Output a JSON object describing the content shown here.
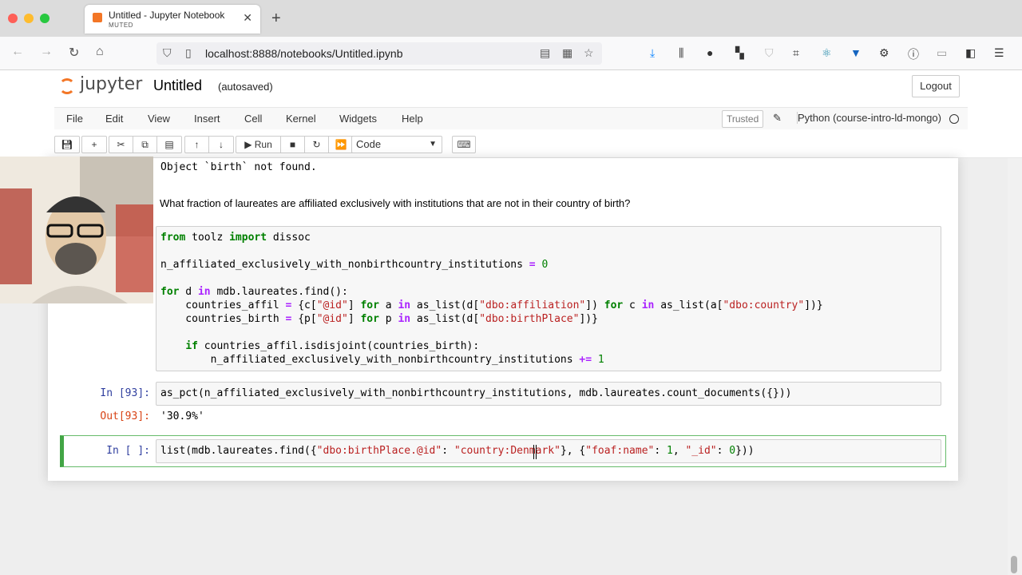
{
  "browser": {
    "tab_title": "Untitled - Jupyter Notebook",
    "tab_subtitle": "MUTED",
    "url": "localhost:8888/notebooks/Untitled.ipynb",
    "colors": {
      "close": "#fe5f57",
      "minimize": "#febc2e",
      "maximize": "#28c840"
    }
  },
  "jupyter": {
    "logo_text": "jupyter",
    "notebook_title": "Untitled",
    "autosave_status": "(autosaved)",
    "logout_label": "Logout",
    "menu": [
      "File",
      "Edit",
      "View",
      "Insert",
      "Cell",
      "Kernel",
      "Widgets",
      "Help"
    ],
    "trusted_label": "Trusted",
    "kernel_name": "Python (course-intro-ld-mongo)",
    "run_label": "Run",
    "cell_type": "Code",
    "accent": "#f37626"
  },
  "cells": {
    "prev_output": "Object `birth` not found.",
    "question": "What fraction of laureates are affiliated exclusively with institutions that are not in their country of birth?",
    "code_lines": [
      "from toolz import dissoc",
      "",
      "n_affiliated_exclusively_with_nonbirthcountry_institutions = 0",
      "",
      "for d in mdb.laureates.find():",
      "    countries_affil = {c[\"@id\"] for a in as_list(d[\"dbo:affiliation\"]) for c in as_list(a[\"dbo:country\"])}",
      "    countries_birth = {p[\"@id\"] for p in as_list(d[\"dbo:birthPlace\"])}",
      "",
      "    if countries_affil.isdisjoint(countries_birth):",
      "        n_affiliated_exclusively_with_nonbirthcountry_institutions += 1"
    ],
    "in93_prompt": "In [93]:",
    "in93_code": "as_pct(n_affiliated_exclusively_with_nonbirthcountry_institutions, mdb.laureates.count_documents({}))",
    "out93_prompt": "Out[93]:",
    "out93_value": "'30.9%'",
    "current_prompt": "In [ ]:",
    "current_code": "list(mdb.laureates.find({\"dbo:birthPlace.@id\": \"country:Denmark\"}, {\"foaf:name\": 1, \"_id\": 0}))"
  }
}
